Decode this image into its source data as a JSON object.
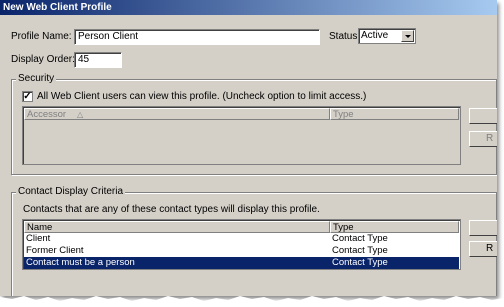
{
  "window": {
    "title": "New Web Client Profile"
  },
  "profile": {
    "name_label": "Profile Name:",
    "name_value": "Person Client",
    "status_label": "Status:",
    "status_value": "Active",
    "order_label": "Display Order:",
    "order_value": "45"
  },
  "security": {
    "title": "Security",
    "checkbox_label": "All Web Client users can view this profile. (Uncheck option to limit access.)",
    "checked": true,
    "columns": [
      "Accessor",
      "Type"
    ],
    "side_buttons": [
      "",
      "R"
    ]
  },
  "contact": {
    "title": "Contact Display Criteria",
    "description": "Contacts that are any of these contact types will display this profile.",
    "columns": [
      "Name",
      "Type"
    ],
    "rows": [
      {
        "name": "Client",
        "type": "Contact Type",
        "selected": false
      },
      {
        "name": "Former Client",
        "type": "Contact Type",
        "selected": false
      },
      {
        "name": "Contact must be a person",
        "type": "Contact Type",
        "selected": true
      }
    ],
    "side_buttons": [
      "",
      "R"
    ]
  }
}
